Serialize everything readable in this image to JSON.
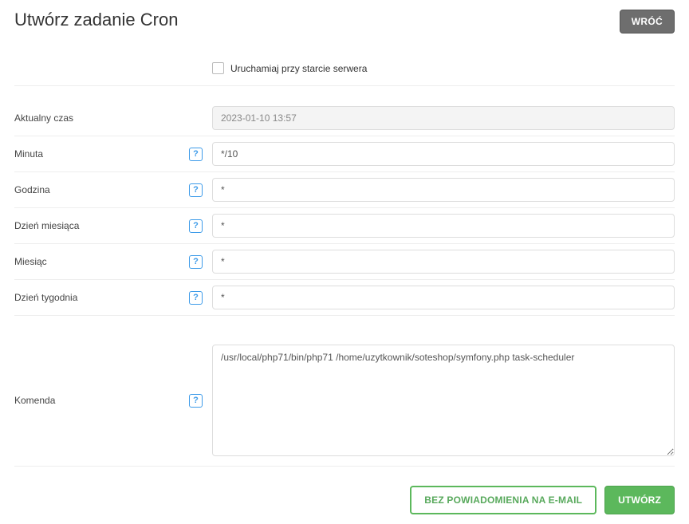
{
  "header": {
    "title": "Utwórz zadanie Cron",
    "back_label": "WRÓĆ"
  },
  "checkbox_row": {
    "label": "Uruchamiaj przy starcie serwera"
  },
  "rows": {
    "current_time": {
      "label": "Aktualny czas",
      "value": "2023-01-10 13:57"
    },
    "minute": {
      "label": "Minuta",
      "value": "*/10"
    },
    "hour": {
      "label": "Godzina",
      "value": "*"
    },
    "dom": {
      "label": "Dzień miesiąca",
      "value": "*"
    },
    "month": {
      "label": "Miesiąc",
      "value": "*"
    },
    "dow": {
      "label": "Dzień tygodnia",
      "value": "*"
    },
    "command": {
      "label": "Komenda",
      "value": "/usr/local/php71/bin/php71 /home/uzytkownik/soteshop/symfony.php task-scheduler"
    }
  },
  "help_glyph": "?",
  "footer": {
    "no_notify_label": "BEZ POWIADOMIENIA NA E-MAIL",
    "create_label": "UTWÓRZ"
  }
}
